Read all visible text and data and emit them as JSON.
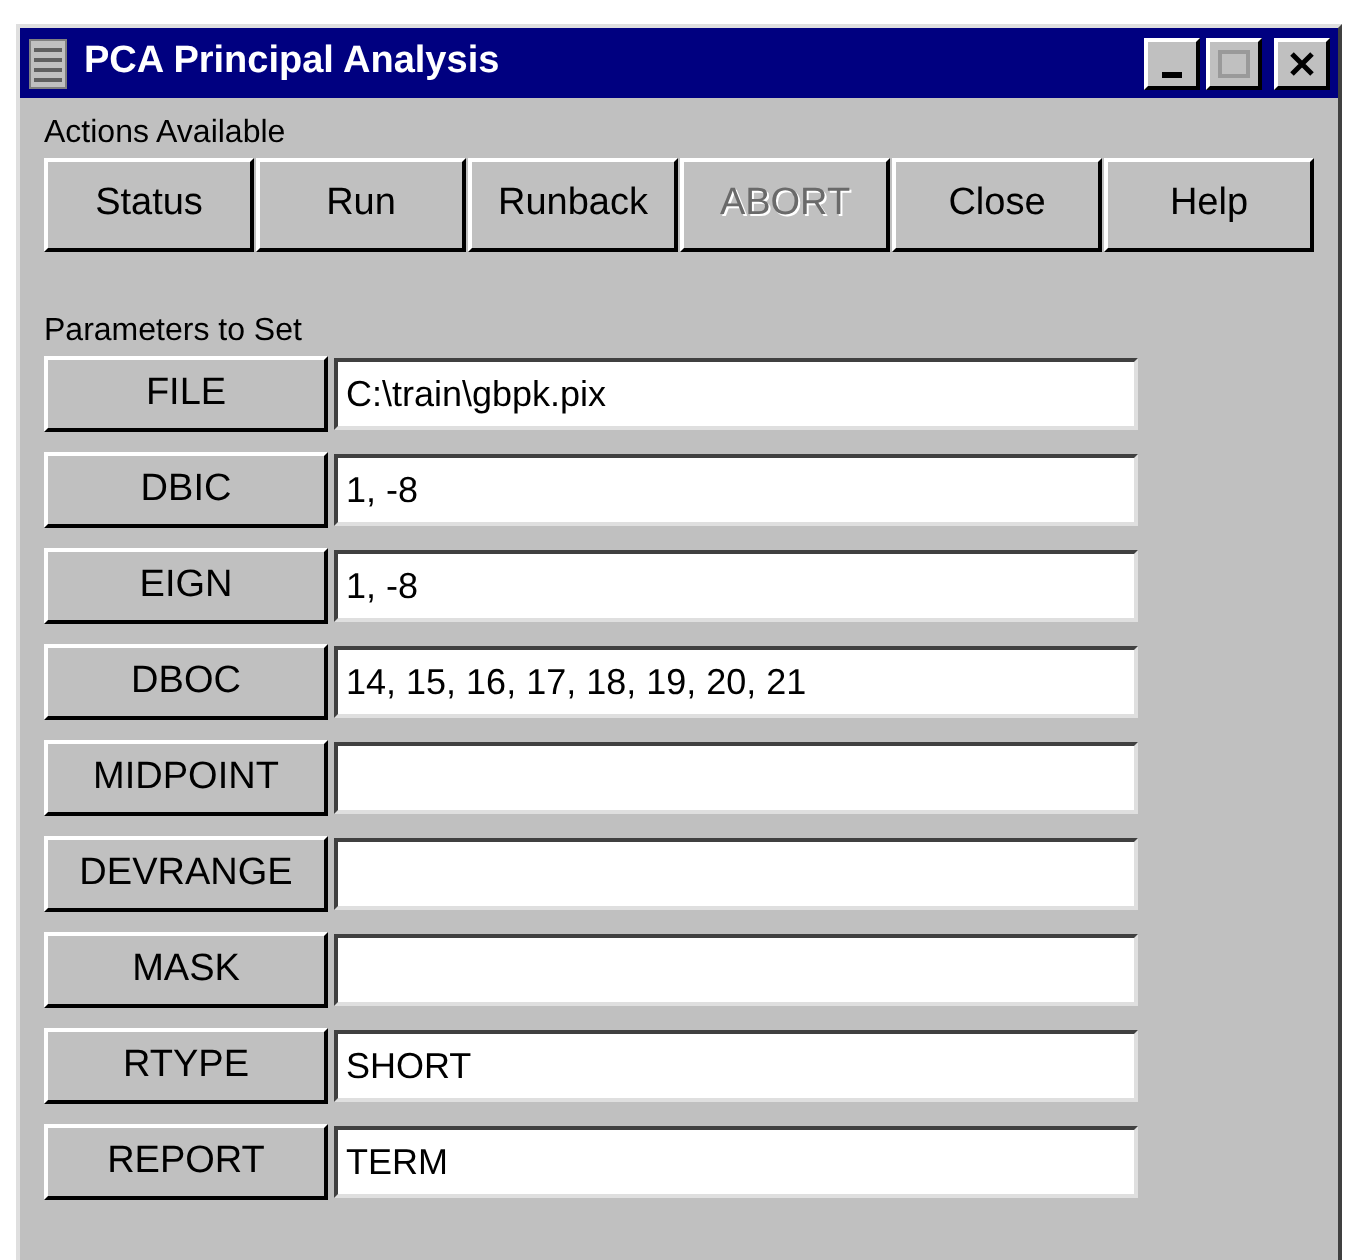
{
  "window": {
    "title": "PCA Principal Analysis"
  },
  "actions": {
    "label": "Actions Available",
    "buttons": [
      {
        "label": "Status",
        "disabled": false
      },
      {
        "label": "Run",
        "disabled": false
      },
      {
        "label": "Runback",
        "disabled": false
      },
      {
        "label": "ABORT",
        "disabled": true
      },
      {
        "label": "Close",
        "disabled": false
      },
      {
        "label": "Help",
        "disabled": false
      }
    ]
  },
  "parameters": {
    "label": "Parameters to Set",
    "rows": [
      {
        "name": "FILE",
        "value": "C:\\train\\gbpk.pix"
      },
      {
        "name": "DBIC",
        "value": "1, -8"
      },
      {
        "name": "EIGN",
        "value": "1, -8"
      },
      {
        "name": "DBOC",
        "value": "14, 15, 16, 17, 18, 19, 20, 21"
      },
      {
        "name": "MIDPOINT"
      },
      {
        "name": "DEVRANGE"
      },
      {
        "name": "MASK"
      },
      {
        "name": "RTYPE",
        "value": "SHORT"
      },
      {
        "name": "REPORT",
        "value": "TERM"
      }
    ]
  }
}
